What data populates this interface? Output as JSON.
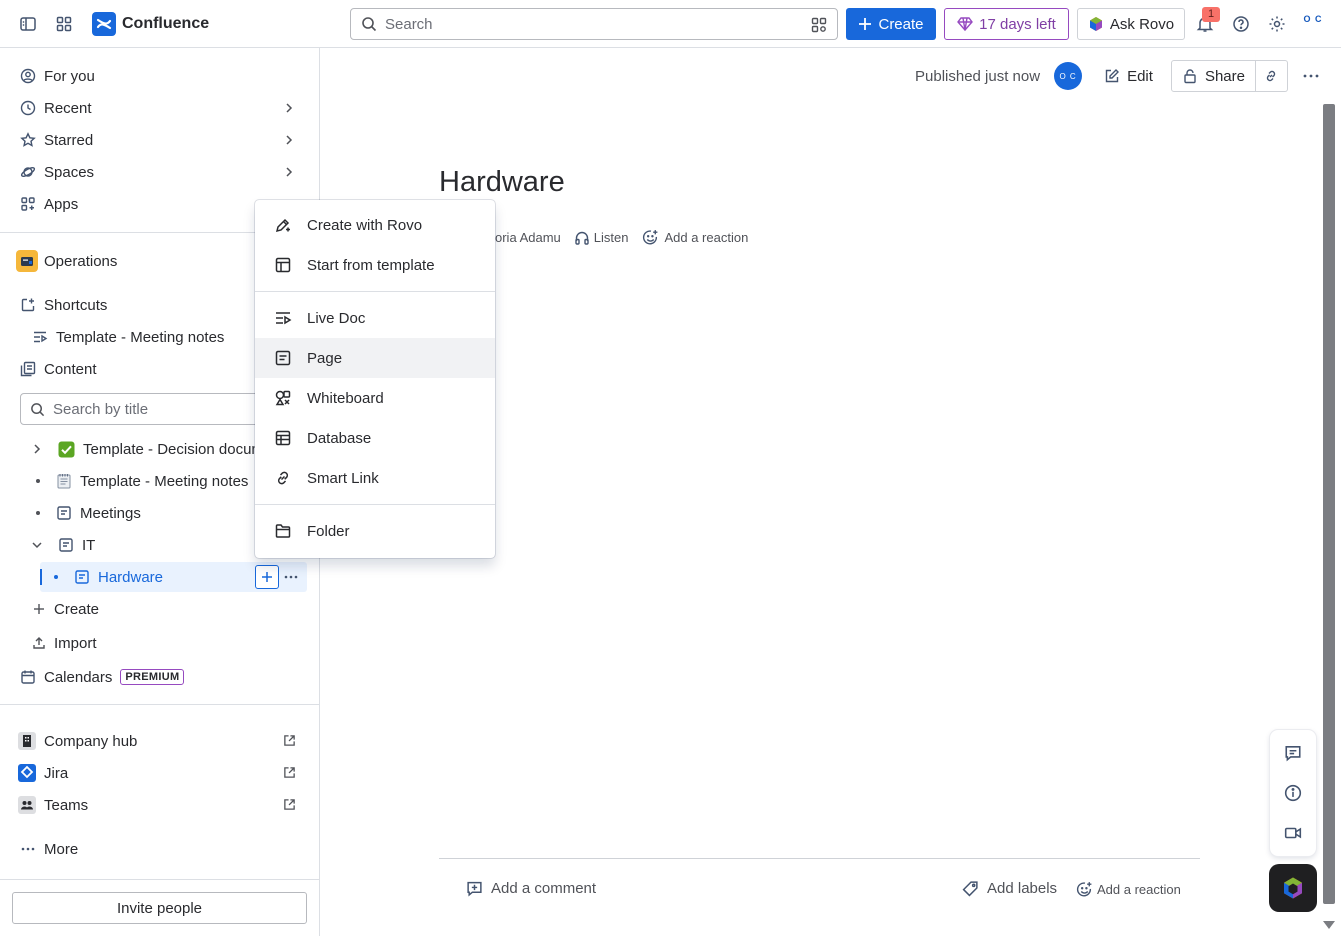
{
  "app": {
    "name": "Confluence"
  },
  "topbar": {
    "search_placeholder": "Search",
    "create_label": "Create",
    "trial_label": "17 days left",
    "rovo_label": "Ask Rovo",
    "notification_count": "1",
    "avatar_initials": "O C"
  },
  "sidebar": {
    "nav": [
      {
        "label": "For you",
        "icon": "user-circle-icon"
      },
      {
        "label": "Recent",
        "icon": "clock-icon"
      },
      {
        "label": "Starred",
        "icon": "star-icon"
      },
      {
        "label": "Spaces",
        "icon": "planet-icon"
      },
      {
        "label": "Apps",
        "icon": "apps-grid-icon"
      }
    ],
    "space_name": "Operations",
    "shortcuts_label": "Shortcuts",
    "shortcut_item": "Template - Meeting notes",
    "content_label": "Content",
    "search_placeholder": "Search by title",
    "tree": [
      {
        "label": "Template - Decision documentation",
        "icon": "checkmark-emoji"
      },
      {
        "label": "Template - Meeting notes",
        "icon": "notepad-emoji"
      },
      {
        "label": "Meetings",
        "icon": "page-icon"
      },
      {
        "label": "IT",
        "icon": "page-icon"
      },
      {
        "label": "Hardware",
        "icon": "page-icon"
      }
    ],
    "create_label": "Create",
    "import_label": "Import",
    "calendars_label": "Calendars",
    "premium_badge": "PREMIUM",
    "links": [
      {
        "label": "Company hub",
        "icon": "building-icon"
      },
      {
        "label": "Jira",
        "icon": "jira-icon"
      },
      {
        "label": "Teams",
        "icon": "teams-icon"
      }
    ],
    "more_label": "More",
    "invite_label": "Invite people"
  },
  "page": {
    "status": "Published just now",
    "author_initials": "O C",
    "edit_label": "Edit",
    "share_label": "Share",
    "title": "Hardware",
    "author_name": "ictoria Adamu",
    "listen_label": "Listen",
    "reaction_label": "Add a reaction",
    "comment_label": "Add a comment",
    "labels_label": "Add labels",
    "footer_reaction_label": "Add a reaction"
  },
  "create_menu": {
    "items": [
      {
        "label": "Create with Rovo",
        "icon": "pencil-sparkle-icon"
      },
      {
        "label": "Start from template",
        "icon": "template-icon"
      },
      {
        "label": "Live Doc",
        "icon": "live-doc-icon"
      },
      {
        "label": "Page",
        "icon": "page-icon"
      },
      {
        "label": "Whiteboard",
        "icon": "whiteboard-icon"
      },
      {
        "label": "Database",
        "icon": "database-icon"
      },
      {
        "label": "Smart Link",
        "icon": "link-icon"
      },
      {
        "label": "Folder",
        "icon": "folder-icon"
      }
    ],
    "highlighted": "Page"
  },
  "colors": {
    "brand": "#1868db",
    "trial": "#964ac0",
    "space_icon": "#f5b73b",
    "active_bg": "#e9f2fe"
  }
}
